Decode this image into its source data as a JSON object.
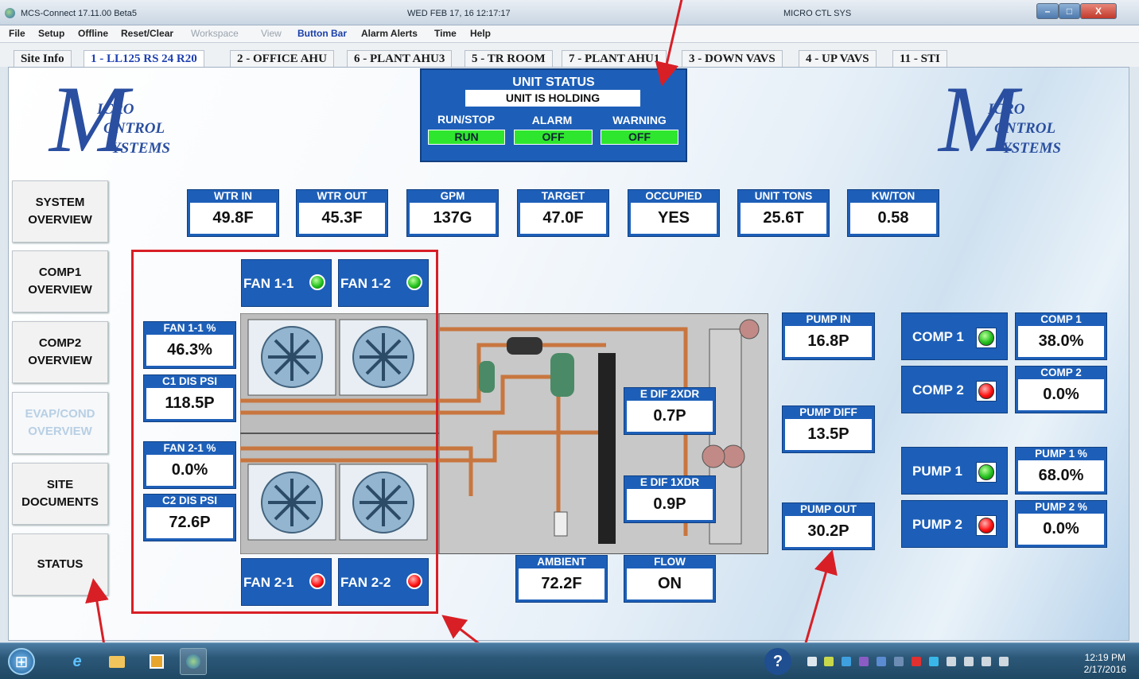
{
  "window": {
    "app_title": "MCS-Connect 17.11.00 Beta5",
    "datetime": "WED FEB 17, 16 12:17:17",
    "system_name": "MICRO CTL SYS",
    "controls": [
      "–",
      "□",
      "X"
    ]
  },
  "menu": [
    "File",
    "Setup",
    "Offline",
    "Reset/Clear",
    "Workspace",
    "View",
    "Button Bar",
    "Alarm Alerts",
    "Time",
    "Help"
  ],
  "tabs": [
    "Site Info",
    "1 - LL125 RS 24 R20",
    "2 - OFFICE AHU",
    "6 - PLANT AHU3",
    "5 - TR ROOM",
    "7 - PLANT AHU1",
    "3 - DOWN VAVS",
    "4 - UP VAVS",
    "11 - STI"
  ],
  "logo": {
    "big": "M",
    "l1": "ICRO",
    "l2": "ONTROL",
    "l3": "YSTEMS"
  },
  "nav": [
    {
      "label": "SYSTEM\nOVERVIEW"
    },
    {
      "label": "COMP1\nOVERVIEW"
    },
    {
      "label": "COMP2\nOVERVIEW"
    },
    {
      "label": "EVAP/COND\nOVERVIEW"
    },
    {
      "label": "SITE\nDOCUMENTS"
    },
    {
      "label": "STATUS"
    }
  ],
  "unit_status": {
    "title": "UNIT STATUS",
    "state": "UNIT IS HOLDING",
    "run_label": "RUN/STOP",
    "run_value": "RUN",
    "alarm_label": "ALARM",
    "alarm_value": "OFF",
    "warning_label": "WARNING",
    "warning_value": "OFF"
  },
  "top_readouts": [
    {
      "label": "WTR IN",
      "value": "49.8F"
    },
    {
      "label": "WTR OUT",
      "value": "45.3F"
    },
    {
      "label": "GPM",
      "value": "137G"
    },
    {
      "label": "TARGET",
      "value": "47.0F"
    },
    {
      "label": "OCCUPIED",
      "value": "YES"
    },
    {
      "label": "UNIT TONS",
      "value": "25.6T"
    },
    {
      "label": "KW/TON",
      "value": "0.58"
    }
  ],
  "fans": [
    {
      "label": "FAN 1-1",
      "status": "green"
    },
    {
      "label": "FAN 1-2",
      "status": "green"
    },
    {
      "label": "FAN 2-1",
      "status": "red"
    },
    {
      "label": "FAN 2-2",
      "status": "red"
    }
  ],
  "left_readouts": [
    {
      "label": "FAN 1-1 %",
      "value": "46.3%"
    },
    {
      "label": "C1 DIS PSI",
      "value": "118.5P"
    },
    {
      "label": "FAN 2-1 %",
      "value": "0.0%"
    },
    {
      "label": "C2 DIS PSI",
      "value": "72.6P"
    }
  ],
  "center_readouts": [
    {
      "label": "E DIF 2XDR",
      "value": "0.7P"
    },
    {
      "label": "E DIF 1XDR",
      "value": "0.9P"
    },
    {
      "label": "AMBIENT",
      "value": "72.2F"
    },
    {
      "label": "FLOW",
      "value": "ON"
    }
  ],
  "pump_readouts": [
    {
      "label": "PUMP IN",
      "value": "16.8P"
    },
    {
      "label": "PUMP DIFF",
      "value": "13.5P"
    },
    {
      "label": "PUMP OUT",
      "value": "30.2P"
    }
  ],
  "equipment": [
    {
      "label": "COMP 1",
      "status": "green",
      "pct_label": "COMP 1",
      "pct": "38.0%"
    },
    {
      "label": "COMP 2",
      "status": "red",
      "pct_label": "COMP 2",
      "pct": "0.0%"
    },
    {
      "label": "PUMP 1",
      "status": "green",
      "pct_label": "PUMP 1 %",
      "pct": "68.0%"
    },
    {
      "label": "PUMP 2",
      "status": "red",
      "pct_label": "PUMP 2 %",
      "pct": "0.0%"
    }
  ],
  "taskbar": {
    "time": "12:19 PM",
    "date": "2/17/2016"
  }
}
